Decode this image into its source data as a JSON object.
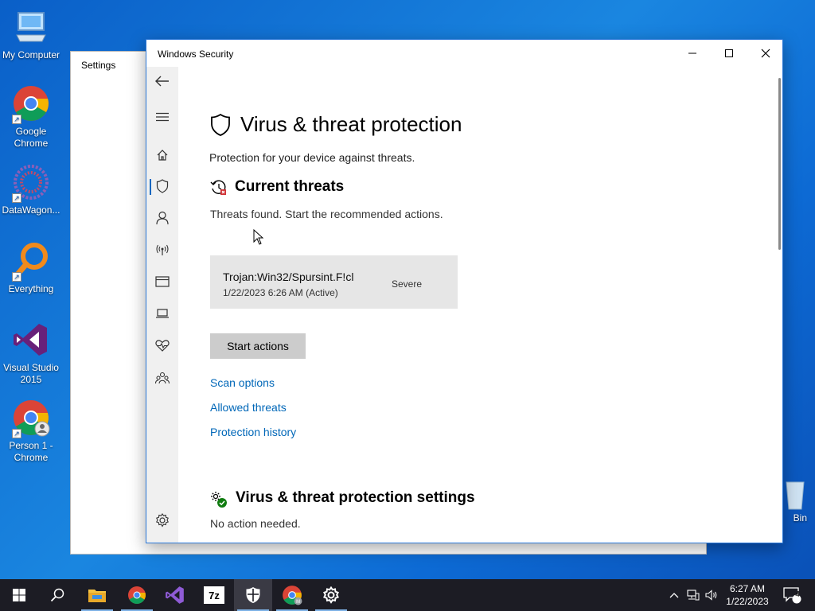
{
  "desktop": {
    "icons": [
      {
        "label": "My Computer"
      },
      {
        "label": "Google Chrome"
      },
      {
        "label": "DataWagon..."
      },
      {
        "label": "Everything"
      },
      {
        "label": "Visual Studio 2015"
      },
      {
        "label": "Person 1 - Chrome"
      }
    ],
    "recycle_label": "Bin"
  },
  "settings_window": {
    "title": "Settings"
  },
  "security_window": {
    "title": "Windows Security",
    "page_title": "Virus & threat protection",
    "page_subtitle": "Protection for your device against threats.",
    "current_threats": {
      "heading": "Current threats",
      "status": "Threats found. Start the recommended actions.",
      "threat": {
        "name": "Trojan:Win32/Spursint.F!cl",
        "date": "1/22/2023 6:26 AM (Active)",
        "severity": "Severe"
      },
      "action_button": "Start actions"
    },
    "links": {
      "scan_options": "Scan options",
      "allowed_threats": "Allowed threats",
      "protection_history": "Protection history"
    },
    "settings_section": {
      "heading": "Virus & threat protection settings",
      "status": "No action needed."
    },
    "nav_items": [
      "back-icon",
      "menu-icon",
      "home-icon",
      "shield-icon",
      "account-icon",
      "firewall-icon",
      "app-browser-icon",
      "device-security-icon",
      "device-health-icon",
      "family-icon",
      "settings-icon"
    ]
  },
  "taskbar": {
    "items": [
      "start-icon",
      "search-icon",
      "file-explorer-icon",
      "chrome-icon",
      "visual-studio-icon",
      "7zip-icon",
      "windows-security-icon",
      "chrome-profile-icon",
      "settings-icon"
    ],
    "time": "6:27 AM",
    "date": "1/22/2023",
    "notification_count": "4"
  },
  "colors": {
    "accent": "#0067b8",
    "taskbar": "#1c1c24",
    "threat_card": "#e6e6e6"
  }
}
